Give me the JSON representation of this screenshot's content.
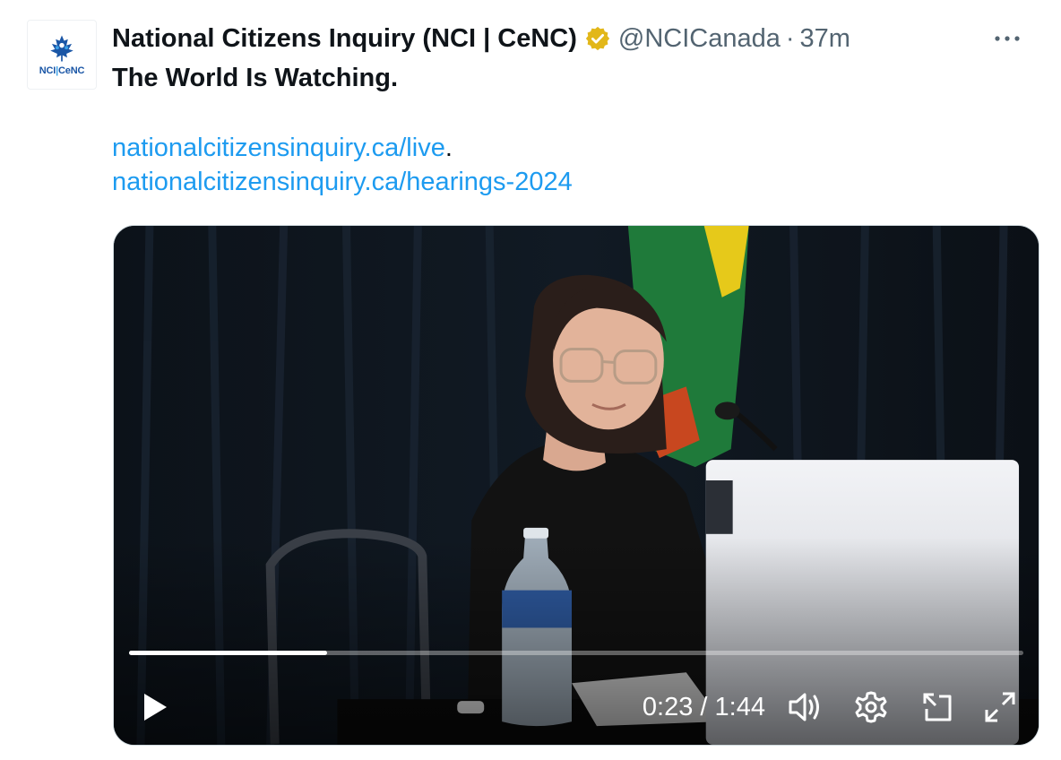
{
  "tweet": {
    "avatar": {
      "label_left": "NCI",
      "label_sep": "|",
      "label_right": "CeNC",
      "icon": "maple-leaf-people-icon"
    },
    "display_name": "National Citizens Inquiry (NCI | CeNC)",
    "verified_icon": "gold-verified-badge-icon",
    "handle": "@NCICanada",
    "separator": "·",
    "timestamp": "37m",
    "more_icon": "more-dots-icon",
    "text": "The World Is Watching.",
    "links": [
      "nationalcitizensinquiry.ca/live",
      "nationalcitizensinquiry.ca/hearings-2024"
    ],
    "link_suffix": "."
  },
  "video": {
    "current_time": "0:23",
    "duration": "1:44",
    "time_separator": " / ",
    "progress_fraction": 0.221,
    "controls": [
      "play-icon",
      "volume-icon",
      "settings-icon",
      "dock-icon",
      "fullscreen-icon"
    ]
  },
  "colors": {
    "link": "#1d9bf0",
    "secondary_text": "#536471",
    "verified_gold": "#e2b719",
    "brand_blue": "#1a56a6"
  }
}
